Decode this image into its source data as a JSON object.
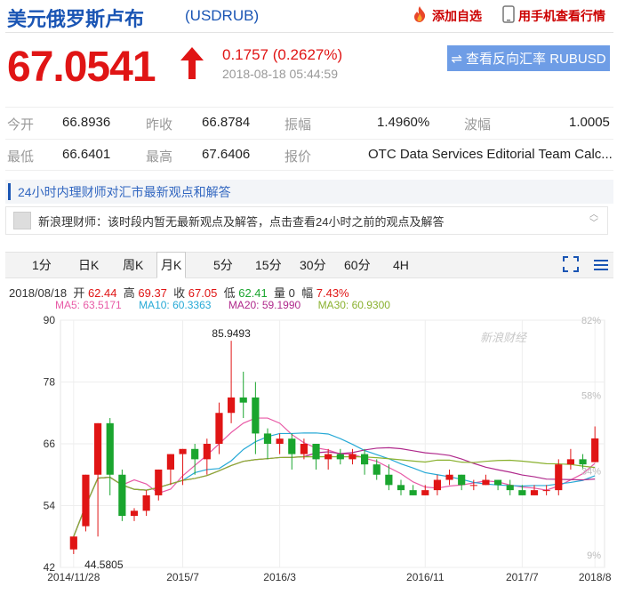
{
  "header": {
    "title": "美元俄罗斯卢布",
    "code": "(USDRUB)",
    "add_fav": "添加自选",
    "mobile": "用手机查看行情"
  },
  "quote": {
    "price": "67.0541",
    "change": "0.1757 (0.2627%)",
    "time": "2018-08-18 05:44:59",
    "reverse_button": "查看反向汇率 RUBUSD"
  },
  "stats": {
    "open_label": "今开",
    "open": "66.8936",
    "prev_label": "昨收",
    "prev": "66.8784",
    "amp_label": "振幅",
    "amp": "1.4960%",
    "vol_label": "波幅",
    "vol": "1.0005",
    "low_label": "最低",
    "low": "66.6401",
    "high_label": "最高",
    "high": "67.6406",
    "quote_label": "报价",
    "quote_src": "OTC Data Services Editorial Team Calc..."
  },
  "expert": {
    "heading": "24小时内理财师对汇市最新观点和解答",
    "message": "新浪理财师：该时段内暂无最新观点及解答，点击查看24小时之前的观点及解答"
  },
  "tabs": [
    "1分",
    "日K",
    "周K",
    "月K",
    "5分",
    "15分",
    "30分",
    "60分",
    "4H"
  ],
  "active_tab": "月K",
  "legend": {
    "date": "2018/08/18",
    "open_label": "开",
    "open": "62.44",
    "high_label": "高",
    "high": "69.37",
    "close_label": "收",
    "close": "67.05",
    "low_label": "低",
    "low": "62.41",
    "vol_label": "量",
    "vol": "0",
    "amp_label": "幅",
    "amp": "7.43%",
    "ma5": "MA5: 63.5171",
    "ma10": "MA10: 60.3363",
    "ma20": "MA20: 59.1990",
    "ma30": "MA30: 60.9300"
  },
  "colors": {
    "up": "#e01515",
    "down": "#1aa52e",
    "ma5": "#e85aa6",
    "ma10": "#26a9d6",
    "ma20": "#b02a8c",
    "ma30": "#8ab12f",
    "accent": "#1a55b4"
  },
  "chart_data": {
    "type": "candlestick",
    "y_ticks": [
      "90",
      "78",
      "66",
      "54",
      "42"
    ],
    "ylim": [
      42,
      90
    ],
    "pct_ticks": [
      "82%",
      "58%",
      "34%",
      "9%"
    ],
    "x_labels": [
      "2014/11/28",
      "2015/7",
      "2016/3",
      "2016/11",
      "2017/7",
      "2018/8"
    ],
    "annotations": [
      "85.9493",
      "44.5805"
    ],
    "watermark": "新浪财经",
    "candles": [
      [
        45.5,
        48.0,
        44.6,
        48.0
      ],
      [
        50,
        60,
        49,
        60
      ],
      [
        60,
        70,
        48,
        70
      ],
      [
        70,
        60,
        56,
        71
      ],
      [
        60,
        52,
        51,
        61
      ],
      [
        52,
        53,
        51,
        53.5
      ],
      [
        53,
        56,
        52,
        57
      ],
      [
        56,
        61,
        55,
        61
      ],
      [
        61,
        64,
        58,
        64
      ],
      [
        64,
        65,
        58,
        65
      ],
      [
        65,
        63,
        60,
        66
      ],
      [
        63,
        66,
        60,
        67
      ],
      [
        66,
        72,
        64,
        74
      ],
      [
        72,
        75,
        70,
        86
      ],
      [
        75,
        74,
        71,
        80
      ],
      [
        75,
        68,
        64,
        78
      ],
      [
        68,
        66,
        63,
        69
      ],
      [
        66,
        67,
        64,
        68
      ],
      [
        67,
        64,
        61,
        68
      ],
      [
        64,
        66,
        63,
        67
      ],
      [
        66,
        63,
        61,
        66
      ],
      [
        63,
        64,
        61,
        65
      ],
      [
        64,
        63,
        62,
        65
      ],
      [
        63,
        64,
        62,
        65
      ],
      [
        64,
        62,
        60,
        65
      ],
      [
        62,
        60,
        59,
        63
      ],
      [
        60,
        58,
        57,
        62
      ],
      [
        58,
        57,
        56,
        59
      ],
      [
        57,
        56,
        56,
        58
      ],
      [
        56,
        57,
        56,
        58
      ],
      [
        57,
        59,
        56,
        60
      ],
      [
        59,
        60,
        58,
        61
      ],
      [
        60,
        58,
        57,
        60
      ],
      [
        58,
        58,
        57,
        59
      ],
      [
        58,
        59,
        58,
        60
      ],
      [
        59,
        58,
        57,
        59
      ],
      [
        58,
        57,
        56,
        59
      ],
      [
        57,
        56,
        56,
        58
      ],
      [
        56,
        57,
        56,
        58
      ],
      [
        57,
        57,
        56,
        58
      ],
      [
        57,
        62,
        56,
        63
      ],
      [
        62,
        63,
        61,
        65
      ],
      [
        63,
        62,
        61,
        64
      ],
      [
        62.44,
        67.05,
        62.41,
        69.37
      ]
    ]
  }
}
